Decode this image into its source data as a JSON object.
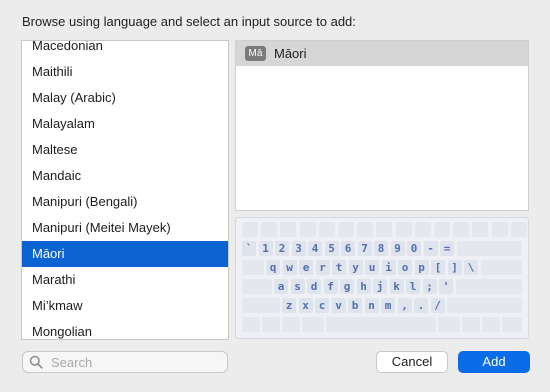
{
  "dialog": {
    "prompt": "Browse using language and select an input source to add:"
  },
  "languages": [
    {
      "label": "Macedonian",
      "selected": false
    },
    {
      "label": "Maithili",
      "selected": false
    },
    {
      "label": "Malay (Arabic)",
      "selected": false
    },
    {
      "label": "Malayalam",
      "selected": false
    },
    {
      "label": "Maltese",
      "selected": false
    },
    {
      "label": "Mandaic",
      "selected": false
    },
    {
      "label": "Manipuri (Bengali)",
      "selected": false
    },
    {
      "label": "Manipuri (Meitei Mayek)",
      "selected": false
    },
    {
      "label": "Māori",
      "selected": true
    },
    {
      "label": "Marathi",
      "selected": false
    },
    {
      "label": "Mi’kmaw",
      "selected": false
    },
    {
      "label": "Mongolian",
      "selected": false
    }
  ],
  "input_sources": [
    {
      "badge": "Mā",
      "name": "Māori"
    }
  ],
  "keyboard": {
    "rows": [
      [
        "`",
        "1",
        "2",
        "3",
        "4",
        "5",
        "6",
        "7",
        "8",
        "9",
        "0",
        "-",
        "="
      ],
      [
        "q",
        "w",
        "e",
        "r",
        "t",
        "y",
        "u",
        "i",
        "o",
        "p",
        "[",
        "]",
        "\\"
      ],
      [
        "a",
        "s",
        "d",
        "f",
        "g",
        "h",
        "j",
        "k",
        "l",
        ";",
        "'"
      ],
      [
        "z",
        "x",
        "c",
        "v",
        "b",
        "n",
        "m",
        ",",
        ".",
        "/"
      ]
    ]
  },
  "search": {
    "placeholder": "Search",
    "value": ""
  },
  "buttons": {
    "cancel": "Cancel",
    "add": "Add"
  },
  "colors": {
    "selection": "#0a63d1",
    "primary_button": "#0a6ce6",
    "key_label": "#5470b0"
  }
}
